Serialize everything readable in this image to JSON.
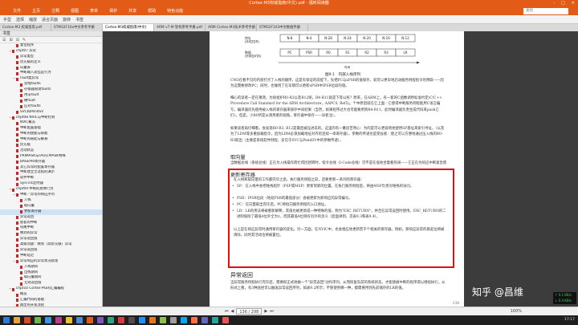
{
  "window": {
    "title": "Cortex-M3权威指南(中文).pdf - 福昕阅读器",
    "controls": [
      "–",
      "□",
      "✕"
    ]
  },
  "menu": {
    "items": [
      "文件",
      "主页",
      "注释",
      "视图",
      "表单",
      "保护",
      "共享",
      "帮助",
      "特色功能"
    ],
    "search_placeholder": "查找"
  },
  "toolbar": {
    "buttons": [
      "手型",
      "选择",
      "缩放",
      "适合页面",
      "旋转",
      "书签"
    ]
  },
  "tabs": [
    {
      "label": "Cortex-M3 权威指南.pdf"
    },
    {
      "label": "STM32F10x中文参考手册"
    },
    {
      "label": "Cortex-M3权威指南(中文)"
    },
    {
      "label": "ARM v7-M 架构参考手册.pdf"
    },
    {
      "label": "ARM Cortex-M3技术参考手册"
    },
    {
      "label": "STM32F103中文数据手册"
    }
  ],
  "bookmarks": {
    "header": "书签",
    "tools": [
      "☰",
      "⊞",
      "⊟",
      "✎"
    ],
    "items": [
      {
        "label": "复位程序",
        "level": 2,
        "toggle": ""
      },
      {
        "label": "chpt07 异常",
        "level": 1,
        "toggle": "−"
      },
      {
        "label": "异常类型",
        "level": 2,
        "toggle": ""
      },
      {
        "label": "优先级的定义",
        "level": 2,
        "toggle": ""
      },
      {
        "label": "向量表",
        "level": 2,
        "toggle": ""
      },
      {
        "label": "中断输入及挂起行为",
        "level": 2,
        "toggle": ""
      },
      {
        "label": "Fault类异常",
        "level": 2,
        "toggle": "−"
      },
      {
        "label": "总线faults",
        "level": 3,
        "toggle": ""
      },
      {
        "label": "存储器管理faults",
        "level": 3,
        "toggle": ""
      },
      {
        "label": "用法fault",
        "level": 3,
        "toggle": ""
      },
      {
        "label": "硬fault",
        "level": 3,
        "toggle": ""
      },
      {
        "label": "应对faults",
        "level": 3,
        "toggle": ""
      },
      {
        "label": "SVC和PendSV",
        "level": 2,
        "toggle": ""
      },
      {
        "label": "chpt08 NVIC与中断控制",
        "level": 1,
        "toggle": "−"
      },
      {
        "label": "NVIC概览",
        "level": 2,
        "toggle": ""
      },
      {
        "label": "中断配置基础",
        "level": 2,
        "toggle": ""
      },
      {
        "label": "中断的使能与除能",
        "level": 2,
        "toggle": ""
      },
      {
        "label": "中断的悬起与解悬",
        "level": 2,
        "toggle": ""
      },
      {
        "label": "优先级",
        "level": 2,
        "toggle": ""
      },
      {
        "label": "活动状态",
        "level": 2,
        "toggle": ""
      },
      {
        "label": "PRIMASK与FAULTMASK特殊",
        "level": 2,
        "toggle": ""
      },
      {
        "label": "BASEPRI寄存器",
        "level": 2,
        "toggle": ""
      },
      {
        "label": "其它异常的配置寄存器",
        "level": 2,
        "toggle": ""
      },
      {
        "label": "中断建立全过程的演示",
        "level": 2,
        "toggle": ""
      },
      {
        "label": "软件中断",
        "level": 2,
        "toggle": ""
      },
      {
        "label": "SysTick定时器",
        "level": 2,
        "toggle": ""
      },
      {
        "label": "chpt09 中断的具体行为",
        "level": 1,
        "toggle": "−"
      },
      {
        "label": "中断／异常的响应序列",
        "level": 2,
        "toggle": "−"
      },
      {
        "label": "入栈",
        "level": 3,
        "toggle": ""
      },
      {
        "label": "取向量",
        "level": 3,
        "toggle": ""
      },
      {
        "label": "更新寄存器",
        "level": 3,
        "toggle": "",
        "selected": true
      },
      {
        "label": "异常返回",
        "level": 2,
        "toggle": ""
      },
      {
        "label": "嵌套的中断",
        "level": 2,
        "toggle": ""
      },
      {
        "label": "咬尾中断",
        "level": 2,
        "toggle": ""
      },
      {
        "label": "晚到的异常",
        "level": 2,
        "toggle": ""
      },
      {
        "label": "异常返回值",
        "level": 2,
        "toggle": ""
      },
      {
        "label": "高级话题：晚到（高优先级）异常",
        "level": 2,
        "toggle": ""
      },
      {
        "label": "异常返回值",
        "level": 2,
        "toggle": ""
      },
      {
        "label": "中断延迟",
        "level": 2,
        "toggle": ""
      },
      {
        "label": "异常响应的异常状况处理",
        "level": 2,
        "toggle": "−"
      },
      {
        "label": "入栈期间",
        "level": 3,
        "toggle": ""
      },
      {
        "label": "出栈期间",
        "level": 3,
        "toggle": ""
      },
      {
        "label": "取向量期间",
        "level": 3,
        "toggle": ""
      },
      {
        "label": "无效返回值",
        "level": 3,
        "toggle": ""
      },
      {
        "label": "chpt10 Cortex-M3的汇编编程",
        "level": 1,
        "toggle": "−"
      },
      {
        "label": "概览",
        "level": 2,
        "toggle": ""
      },
      {
        "label": "汇编代码的基础",
        "level": 2,
        "toggle": ""
      },
      {
        "label": "典型的开发流程",
        "level": 2,
        "toggle": ""
      },
      {
        "label": "使用汇编语言",
        "level": 2,
        "toggle": ""
      },
      {
        "label": "第一步工作",
        "level": 2,
        "toggle": ""
      },
      {
        "label": "与外界交互",
        "level": 2,
        "toggle": ""
      },
      {
        "label": "\"Hello World\"小例程序",
        "level": 2,
        "toggle": ""
      },
      {
        "label": "使用数据存储器",
        "level": 2,
        "toggle": ""
      }
    ]
  },
  "page": {
    "figure": {
      "caption": "图9.1　内部入栈序列",
      "row1_label": "地址\n(HADDR)",
      "row1_cells": [
        "N-8",
        "N-4",
        "N-28",
        "N-24",
        "N-20",
        "N-16",
        "N-12"
      ],
      "row2_label": "数据\n(HWDATA)",
      "row2_cells": [
        "PC",
        "PSR",
        "R0",
        "R1",
        "R2",
        "R3",
        "LR"
      ],
      "time_label": "时间"
    },
    "para1": "CM3在看不见的内部打点了入栈的顺序，这是有保证的前提下，先把PC与xPSR的值保存，就可以更早地启动服务例程指令的预取——因为这需要修改PC；同时，也做到了在早期可以更新xPSR中IPSR位段的值。",
    "para2": "细心的读者一定在猜测，为啥袒护R0-R3以及R12呢，R4-R11就是下等公民？原来，在ARM上，有一套的C函数调用标准约定(C/C++ Procedure Call Standard for the ARM Architecture，AAPCS, Ref5)。个中原因就在它上面：它使得中断服务例程能用C语言编写，编译器优先使用被入栈的寄存器来保存中间结果（当然，如果程序过大也可能要用到R4-R11，此时编译器负责生成代码来push它们）。但是，小R0所是从调用者的视角，寄存器中保存——详者注）。",
    "para3": "如果读者再仔细看，会发现R0-R3, R12是最后被压进去的。这里的有一番良苦用心：为的是可以更容易地使用SP基址来索引寻址，（以及为了LDM等多重加载指令，因为LDM必须加载地址对齐的连续一串寄存器）。参数的传递也是受益者：使之可以方便地通过压入栈的R0-R3取出（主要是系统软件例程，多见于SVC与PendSV中的参数传递）。",
    "sec1": "取向量",
    "para4": "当数据总线（系统总线）正在为入栈操作而忙得团团转时，指令总线（I-Code总线）可不是在低地坐着看热闹——它正在为响应中断紧急而辛地执行另一项重要的任务：从向量表中找出正确的异常向量，然后在服务程序的入口处预取指。由此可以看到各自都有专用总线的好处：入栈与取指这两个工作能同时进行。",
    "sec2": "更新寄存器",
    "para5": "在入栈和取向量的工作都完毕之后，执行服务例程之前，还要更新一系列的寄存器：",
    "bullets": [
      "SP：在入栈中会把堆栈指针（PSP或MSP）更新到新的位置。在执行服务例程后，将由MSP负责对堆栈的访问。",
      "PSR：IPSR位段（地处PSR的最低部分）会被更新为新响应的异常编号。",
      "PC：在向量取出完毕后，PC将指向服务例程的入口地址，",
      "LR：LR的用法将被重新解释，其值也被更新成一种特殊的值，称为\"EXC_RETURN\"，并且在异常返回时使用。EXC_RETURN的二进制值除了最低4位外全为1，而其最低4位则有另外的含义（后面讲到，见表9.3和表9.4）。"
    ],
    "para6": "以上是在响应异常时通用寄存器的变化。另一方面，在NVIC中，也会相应地更新若干个相关的寄存器。例如，新响应异常的悬起位将被清除，同时其活动位将被置位。",
    "sec3": "异常返回",
    "para7": "当异常服务例程执行完毕后，需要很正式地做一个\"异常返回\"动作序列，从而恢复先前的系统状态，才能使被中断的程序得以继续执行。从形式上看，有3种途径可以触发异常返回序列，如表9.2所示；不管使用哪一种，都需要用到先前储存的LR的值。",
    "page_number": "138"
  },
  "status": {
    "page_display": "136 / 298",
    "zoom": "100%"
  },
  "overlay": {
    "watermark": "知乎 @昌维",
    "net_up": "↑ 0.1 KB/s",
    "net_down": "↓ 0.4 KB/s"
  },
  "taskbar": {
    "time": "17:17",
    "icons": [
      "#2f7bd6",
      "#e8a33c",
      "#d84a2a",
      "#6bb84a",
      "#3b96e0",
      "#c23c8c",
      "#f2c02e",
      "#4a8bd6",
      "#e25b17",
      "#7a56c8",
      "#2fa37a",
      "#dd3b3b",
      "#4e4e4e",
      "#1e90ff",
      "#e07a22",
      "#8bc34a",
      "#9e9e9e",
      "#03a9f4",
      "#ff7043",
      "#5c6bc0",
      "#26a69a",
      "#ef5350"
    ]
  },
  "colors": {
    "accent": "#e25b17",
    "highlight_box": "#e01010",
    "selection": "#cde3f7"
  }
}
